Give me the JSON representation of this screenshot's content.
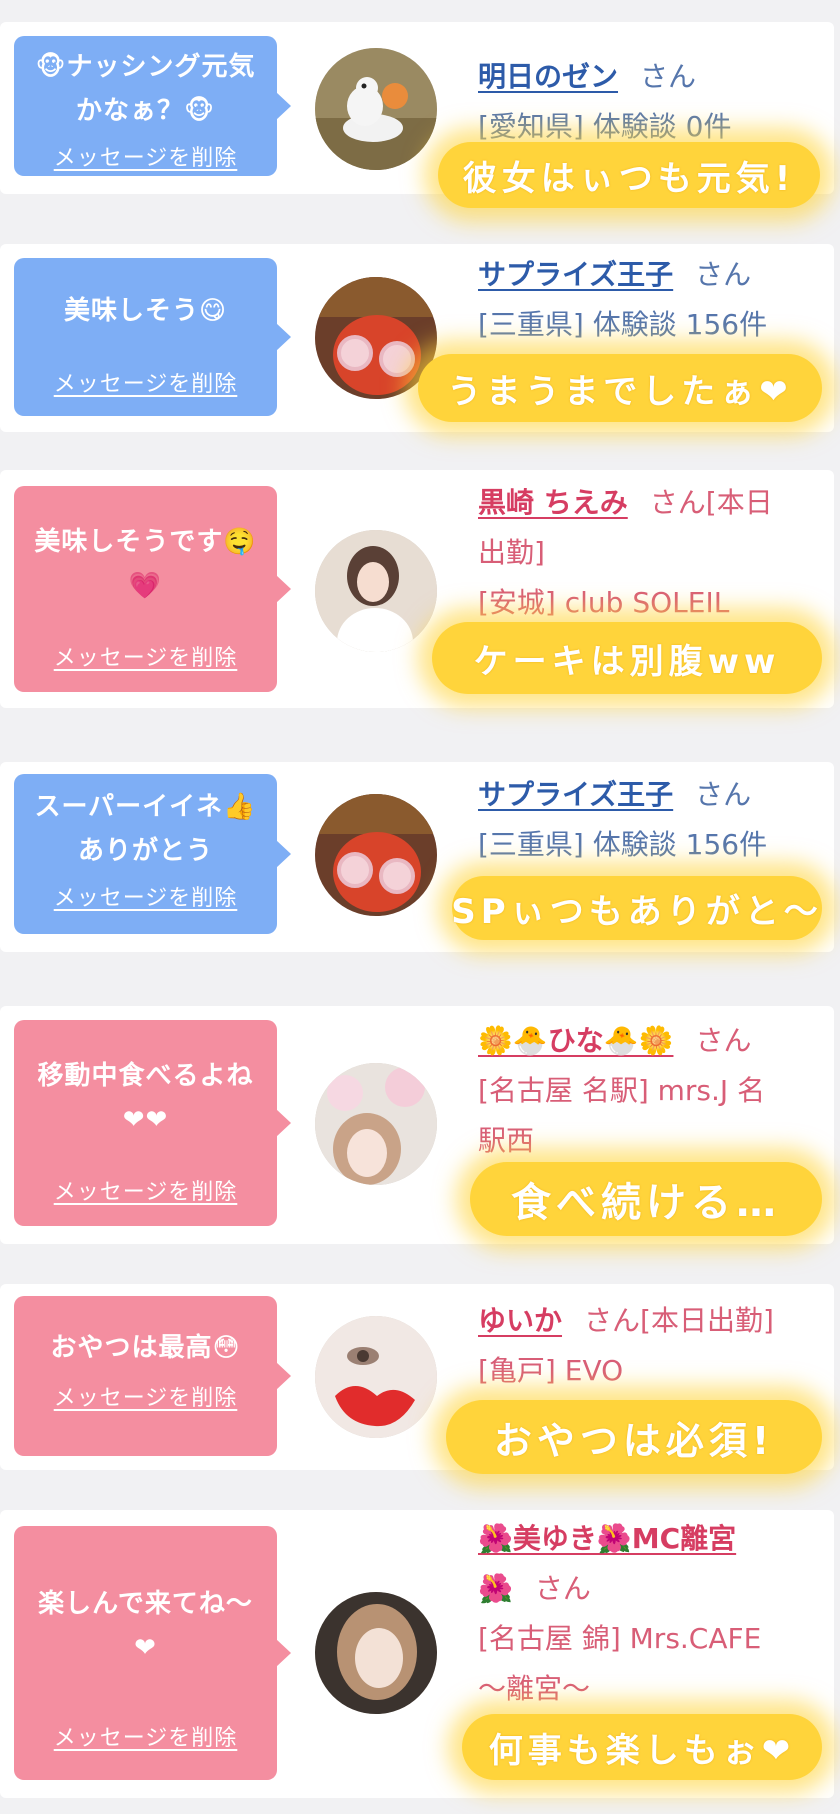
{
  "delete_label": "メッセージを削除",
  "san_label": "さん",
  "colors": {
    "blue_bubble": "#7eaef5",
    "pink_bubble": "#f48ea0",
    "sticker": "#ffd43b",
    "link_blue": "#2d5ba9",
    "link_pink": "#d63d62"
  },
  "messages": [
    {
      "message_lines": [
        "🐵ナッシング元気",
        "かなぁ？🐵"
      ],
      "user_name": "明日のゼン",
      "name_suffix": "",
      "details": [
        "[愛知県] 体験談 0件"
      ],
      "sticker_text": "彼女はぃつも元気!",
      "bubble_color": "blue",
      "avatar_icon": "snake-plush-icon"
    },
    {
      "message_lines": [
        "美味しそう😋"
      ],
      "user_name": "サプライズ王子",
      "name_suffix": "",
      "details": [
        "[三重県] 体験談 156件"
      ],
      "sticker_text": "うまうまでしたぁ❤",
      "bubble_color": "blue",
      "avatar_icon": "person-with-glasses-icon"
    },
    {
      "message_lines": [
        "美味しそうです🤤",
        "💗"
      ],
      "user_name": "黒崎 ちえみ",
      "name_suffix": "[本日",
      "details": [
        "出勤]",
        "[安城] club SOLEIL"
      ],
      "sticker_text": "ケーキは別腹ww",
      "bubble_color": "pink",
      "avatar_icon": "woman-photo-icon"
    },
    {
      "message_lines": [
        "スーパーイイネ👍",
        "ありがとう"
      ],
      "user_name": "サプライズ王子",
      "name_suffix": "",
      "details": [
        "[三重県] 体験談 156件"
      ],
      "sticker_text": "SPぃつもありがと〜",
      "bubble_color": "blue",
      "avatar_icon": "person-with-glasses-icon"
    },
    {
      "message_lines": [
        "移動中食べるよね",
        "❤❤"
      ],
      "user_name": "🌼🐣ひな🐣🌼",
      "name_suffix": "",
      "details": [
        "[名古屋 名駅] mrs.J 名",
        "駅西"
      ],
      "sticker_text": "食べ続ける…",
      "bubble_color": "pink",
      "avatar_icon": "woman-blossom-icon"
    },
    {
      "message_lines": [
        "おやつは最高😳"
      ],
      "user_name": "ゆいか",
      "name_suffix": "[本日出勤]",
      "details": [
        "[亀戸] EVO"
      ],
      "sticker_text": "おやつは必須!",
      "bubble_color": "pink",
      "avatar_icon": "woman-closeup-icon"
    },
    {
      "message_lines": [
        "楽しんで来てね〜",
        "❤"
      ],
      "user_name": "🌺美ゆき🌺MC離宮",
      "name_suffix": "",
      "details": [
        "🌺",
        "[名古屋 錦] Mrs.CAFE",
        "〜離宮〜"
      ],
      "sticker_text": "何事も楽しもぉ❤",
      "bubble_color": "pink",
      "avatar_icon": "woman-portrait-icon"
    }
  ]
}
